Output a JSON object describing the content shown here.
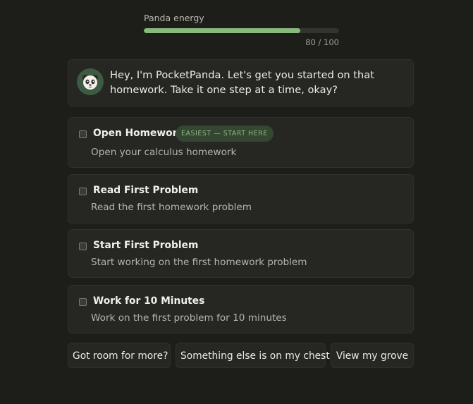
{
  "energy": {
    "label": "Panda energy",
    "value": 80,
    "max": 100,
    "display": "80 / 100",
    "color": "#86b97a"
  },
  "greeting": {
    "avatar_icon": "panda-icon",
    "text": "Hey, I'm PocketPanda. Let's get you started on that homework. Take it one step at a time, okay?"
  },
  "tasks": [
    {
      "title": "Open Homework",
      "badge": "EASIEST — START HERE",
      "description": "Open your calculus homework",
      "checked": false
    },
    {
      "title": "Read First Problem",
      "description": "Read the first homework problem",
      "checked": false
    },
    {
      "title": "Start First Problem",
      "description": "Start working on the first homework problem",
      "checked": false
    },
    {
      "title": "Work for 10 Minutes",
      "description": "Work on the first problem for 10 minutes",
      "checked": false
    }
  ],
  "actions": {
    "more_label": "Got room for more?",
    "chest_label": "Something else is on my chest",
    "grove_label": "View my grove"
  }
}
